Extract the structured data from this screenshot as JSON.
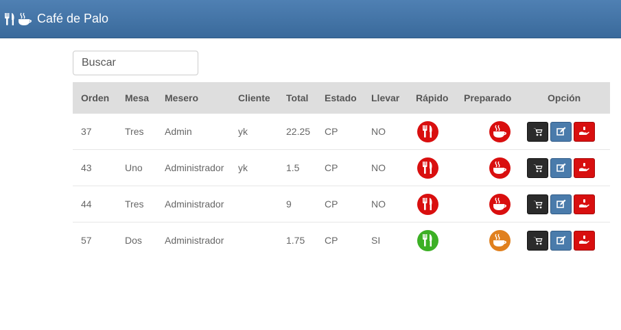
{
  "app": {
    "title": "Café de Palo"
  },
  "search": {
    "placeholder": "Buscar"
  },
  "table": {
    "headers": {
      "orden": "Orden",
      "mesa": "Mesa",
      "mesero": "Mesero",
      "cliente": "Cliente",
      "total": "Total",
      "estado": "Estado",
      "llevar": "Llevar",
      "rapido": "Rápido",
      "preparado": "Preparado",
      "opcion": "Opción"
    },
    "rows": [
      {
        "orden": "37",
        "mesa": "Tres",
        "mesero": "Admin",
        "cliente": "yk",
        "total": "22.25",
        "estado": "CP",
        "llevar": "NO",
        "rapido_color": "#d90f0f",
        "preparado_color": "#d90f0f"
      },
      {
        "orden": "43",
        "mesa": "Uno",
        "mesero": "Administrador",
        "cliente": "yk",
        "total": "1.5",
        "estado": "CP",
        "llevar": "NO",
        "rapido_color": "#d90f0f",
        "preparado_color": "#d90f0f"
      },
      {
        "orden": "44",
        "mesa": "Tres",
        "mesero": "Administrador",
        "cliente": "",
        "total": "9",
        "estado": "CP",
        "llevar": "NO",
        "rapido_color": "#d90f0f",
        "preparado_color": "#d90f0f"
      },
      {
        "orden": "57",
        "mesa": "Dos",
        "mesero": "Administrador",
        "cliente": "",
        "total": "1.75",
        "estado": "CP",
        "llevar": "SI",
        "rapido_color": "#3cb025",
        "preparado_color": "#e0801e"
      }
    ]
  },
  "icons": {
    "brand": [
      "cutlery-icon",
      "coffee-cup-icon"
    ],
    "rapido": "cutlery-icon",
    "preparado": "coffee-cup-icon",
    "options": [
      "cart-icon",
      "edit-icon",
      "hand-coin-icon"
    ]
  },
  "colors": {
    "navbar": "#4278aa",
    "header_row": "#dedede",
    "btn_dark": "#2b2b2b",
    "btn_blue": "#4a7bab",
    "btn_red": "#d80f0f"
  }
}
